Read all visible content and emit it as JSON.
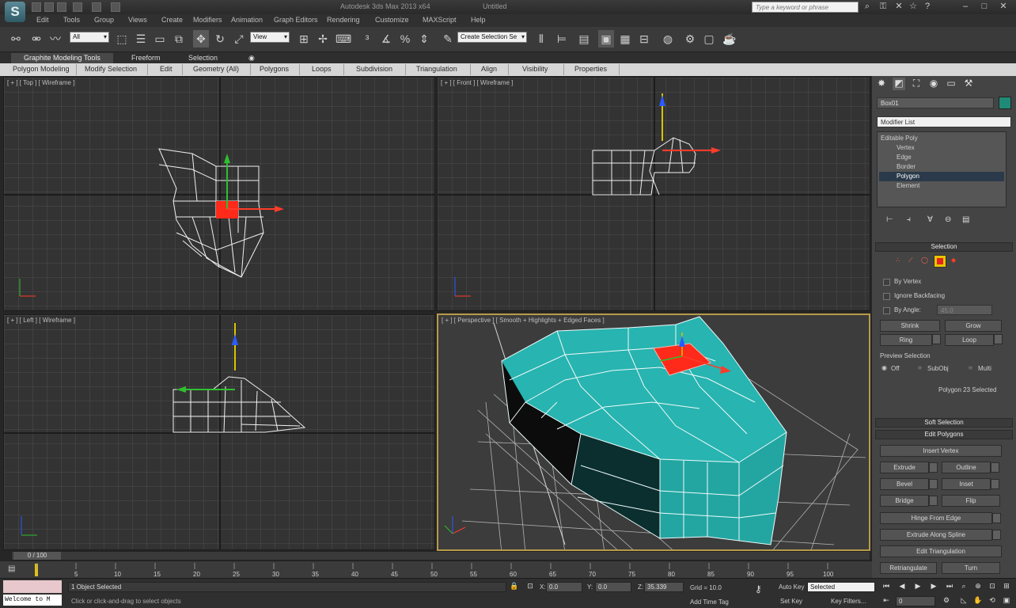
{
  "window": {
    "title": "Autodesk 3ds Max 2013 x64",
    "doc": "Untitled"
  },
  "search": {
    "placeholder": "Type a keyword or phrase"
  },
  "menu": [
    "Edit",
    "Tools",
    "Group",
    "Views",
    "Create",
    "Modifiers",
    "Animation",
    "Graph Editors",
    "Rendering",
    "Customize",
    "MAXScript",
    "Help"
  ],
  "toolbar": {
    "filter": "All",
    "ref_coord": "View",
    "named_sel": "Create Selection Se"
  },
  "ribbon": {
    "tabs": [
      "Graphite Modeling Tools",
      "Freeform",
      "Selection"
    ],
    "panels": [
      "Polygon Modeling",
      "Modify Selection",
      "Edit",
      "Geometry (All)",
      "Polygons",
      "Loops",
      "Subdivision",
      "Triangulation",
      "Align",
      "Visibility",
      "Properties"
    ]
  },
  "viewports": {
    "top": "[ + ] [ Top ] [ Wireframe ]",
    "front": "[ + ] [ Front ] [ Wireframe ]",
    "left": "[ + ] [ Left ] [ Wireframe ]",
    "persp": "[ + ] [ Perspective ] [ Smooth + Highlights + Edged Faces ]"
  },
  "command_panel": {
    "object_name": "Box01",
    "modifier_list": "Modifier List",
    "object_color": "#1f8a78",
    "stack": [
      "Editable Poly",
      "Vertex",
      "Edge",
      "Border",
      "Polygon",
      "Element"
    ],
    "selected_stack": "Polygon",
    "selection_rollout": "Selection",
    "by_vertex": "By Vertex",
    "ignore_backfacing": "Ignore Backfacing",
    "by_angle": "By Angle:",
    "angle_value": "45.0",
    "shrink": "Shrink",
    "grow": "Grow",
    "ring": "Ring",
    "loop": "Loop",
    "preview": "Preview Selection",
    "preview_opts": [
      "Off",
      "SubObj",
      "Multi"
    ],
    "selection_status": "Polygon 23 Selected",
    "soft_selection": "Soft Selection",
    "edit_polygons": "Edit Polygons",
    "insert_vertex": "Insert Vertex",
    "extrude": "Extrude",
    "outline": "Outline",
    "bevel": "Bevel",
    "inset": "Inset",
    "bridge": "Bridge",
    "flip": "Flip",
    "hinge": "Hinge From Edge",
    "extrude_spline": "Extrude Along Spline",
    "edit_tri": "Edit Triangulation",
    "retri": "Retriangulate",
    "turn": "Turn"
  },
  "timeline": {
    "frame": "0 / 100",
    "ticks": [
      "5",
      "10",
      "15",
      "20",
      "25",
      "30",
      "35",
      "40",
      "45",
      "50",
      "55",
      "60",
      "65",
      "70",
      "75",
      "80",
      "85",
      "90",
      "95",
      "100"
    ]
  },
  "status": {
    "welcome": "Welcome to M",
    "objects": "1 Object Selected",
    "prompt": "Click or click-and-drag to select objects",
    "x": "0.0",
    "y": "0.0",
    "z": "35.339",
    "grid": "Grid = 10.0",
    "add_time_tag": "Add Time Tag",
    "auto_key": "Auto Key",
    "selected": "Selected",
    "set_key": "Set Key",
    "key_filters": "Key Filters...",
    "frame": "0"
  },
  "colors": {
    "mesh": "#28b4b0",
    "selection": "#ff2a1a",
    "active_border": "#b79a4a"
  }
}
